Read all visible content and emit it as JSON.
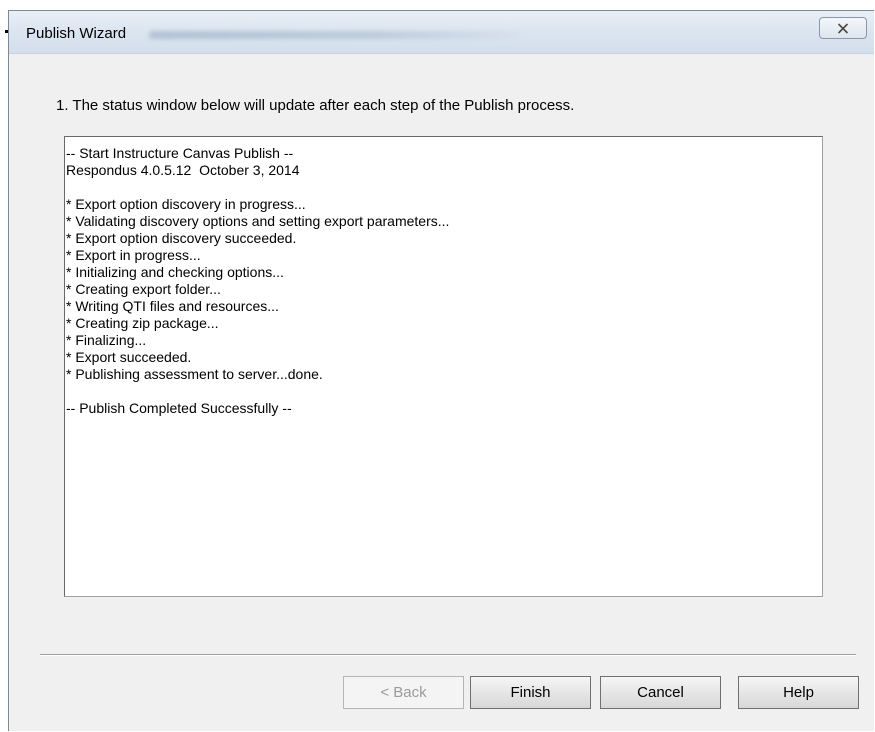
{
  "window": {
    "title": "Publish Wizard",
    "close_icon": "close-x-icon"
  },
  "instruction": "1.  The status window below will update after each step of the Publish process.",
  "status_lines": [
    "-- Start Instructure Canvas Publish --",
    "Respondus 4.0.5.12  October 3, 2014",
    "",
    "* Export option discovery in progress...",
    "* Validating discovery options and setting export parameters...",
    "* Export option discovery succeeded.",
    "* Export in progress...",
    "* Initializing and checking options...",
    "* Creating export folder...",
    "* Writing QTI files and resources...",
    "* Creating zip package...",
    "* Finalizing...",
    "* Export succeeded.",
    "* Publishing assessment to server...done.",
    "",
    "-- Publish Completed Successfully --"
  ],
  "buttons": {
    "back": "< Back",
    "finish": "Finish",
    "cancel": "Cancel",
    "help": "Help"
  },
  "colors": {
    "dialog_bg": "#f0f0f0",
    "titlebar": "#dbe5f0",
    "disabled_text": "#9a9a9a"
  }
}
